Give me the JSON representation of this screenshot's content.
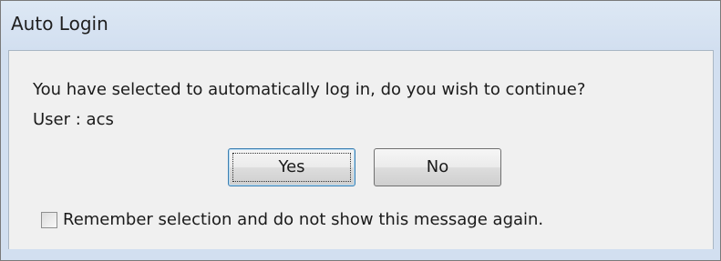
{
  "window": {
    "title": "Auto Login"
  },
  "dialog": {
    "message": "You have selected to automatically log in, do you wish to continue?",
    "user_line": "User : acs",
    "yes_label": "Yes",
    "no_label": "No",
    "remember_label": "Remember selection and do not show this message again.",
    "remember_checked": false
  },
  "colors": {
    "title_bar": "#d6e2ef",
    "client_background": "#f0f0f0",
    "default_button_border": "#3c7fb1"
  }
}
